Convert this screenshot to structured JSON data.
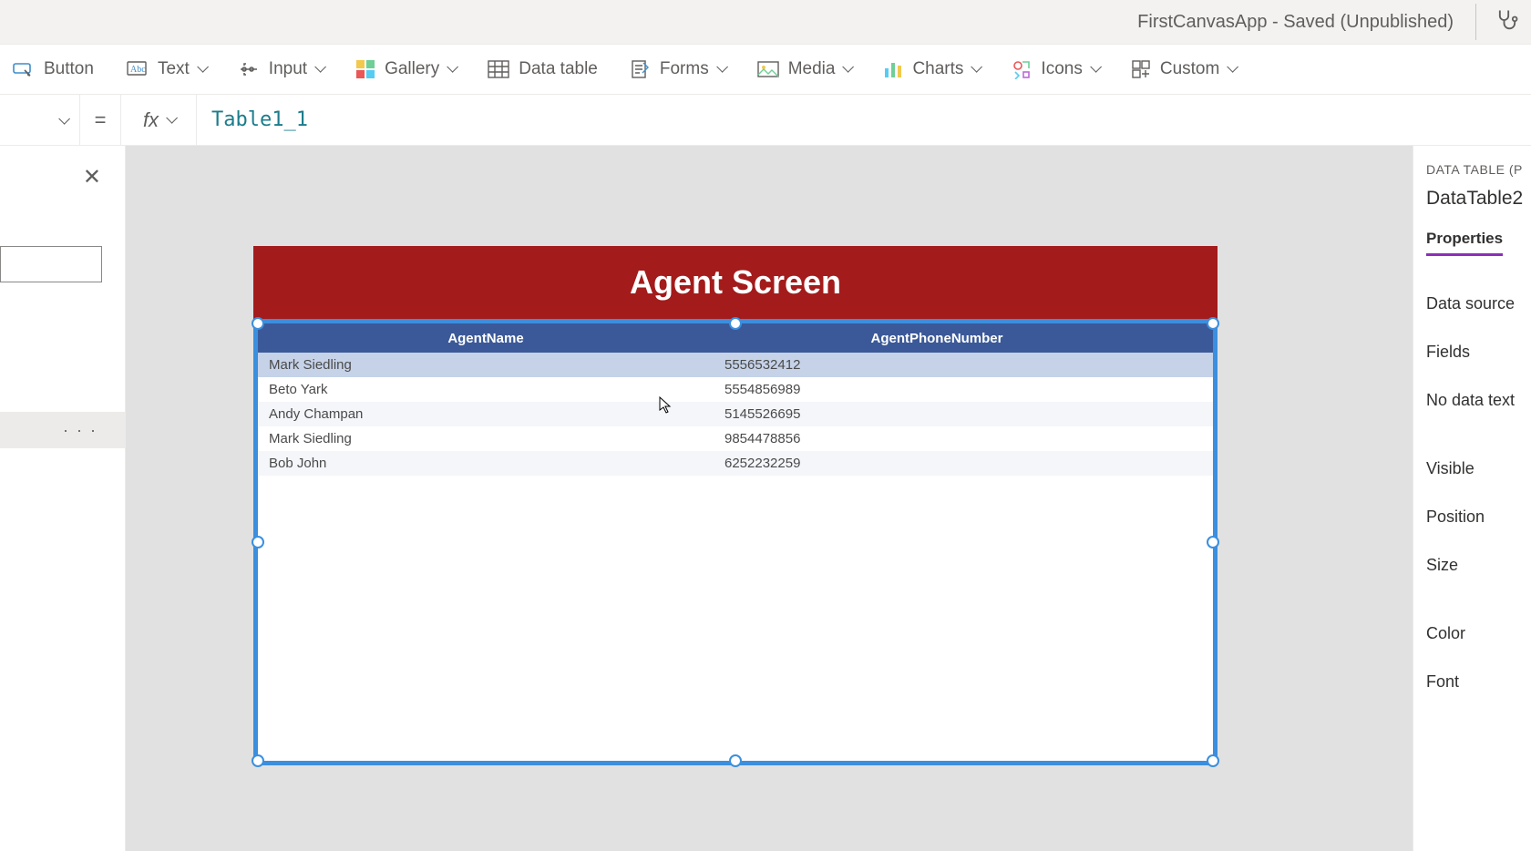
{
  "title_bar": {
    "app_title": "FirstCanvasApp - Saved (Unpublished)"
  },
  "ribbon": {
    "button": "Button",
    "text": "Text",
    "input": "Input",
    "gallery": "Gallery",
    "data_table": "Data table",
    "forms": "Forms",
    "media": "Media",
    "charts": "Charts",
    "icons": "Icons",
    "custom": "Custom"
  },
  "formula": {
    "equals": "=",
    "fx": "fx",
    "value": "Table1_1"
  },
  "left": {
    "more": "· · ·"
  },
  "screen": {
    "title": "Agent Screen",
    "table": {
      "headers": [
        "AgentName",
        "AgentPhoneNumber"
      ],
      "rows": [
        {
          "name": "Mark Siedling",
          "phone": "5556532412"
        },
        {
          "name": "Beto Yark",
          "phone": "5554856989"
        },
        {
          "name": "Andy Champan",
          "phone": "5145526695"
        },
        {
          "name": "Mark Siedling",
          "phone": "9854478856"
        },
        {
          "name": "Bob John",
          "phone": "6252232259"
        }
      ]
    }
  },
  "right": {
    "section": "DATA TABLE (P",
    "ctrl_name": "DataTable2",
    "tab_properties": "Properties",
    "props": {
      "data_source": "Data source",
      "fields": "Fields",
      "no_data_text": "No data text",
      "visible": "Visible",
      "position": "Position",
      "size": "Size",
      "color": "Color",
      "font": "Font"
    }
  }
}
